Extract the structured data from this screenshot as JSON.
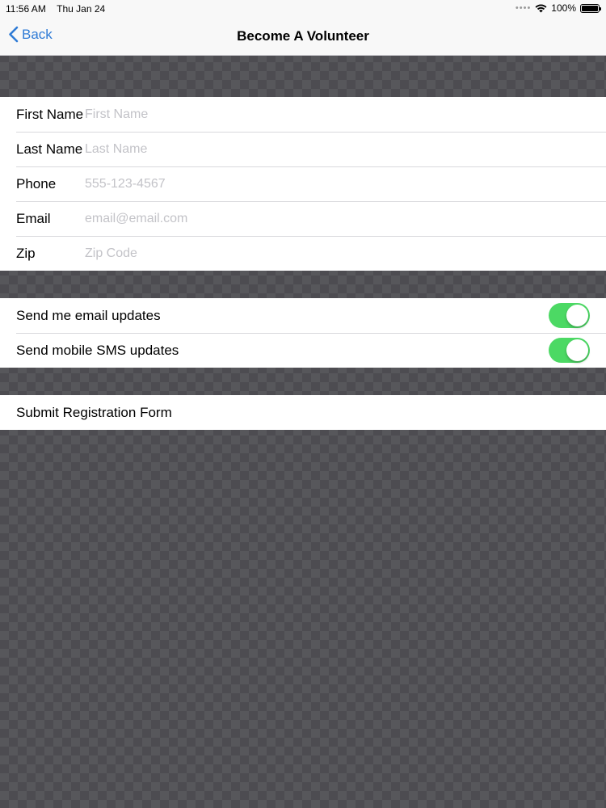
{
  "status_bar": {
    "time": "11:56 AM",
    "date": "Thu Jan 24",
    "battery": "100%",
    "signal_icon": "cellular-dots-icon",
    "wifi_icon": "wifi-icon",
    "battery_icon": "battery-icon"
  },
  "nav": {
    "back_label": "Back",
    "title": "Become A Volunteer"
  },
  "form": {
    "fields": [
      {
        "label": "First Name",
        "value": "",
        "placeholder": "First Name"
      },
      {
        "label": "Last Name",
        "value": "",
        "placeholder": "Last Name"
      },
      {
        "label": "Phone",
        "value": "",
        "placeholder": "555-123-4567"
      },
      {
        "label": "Email",
        "value": "",
        "placeholder": "email@email.com"
      },
      {
        "label": "Zip",
        "value": "",
        "placeholder": "Zip Code"
      }
    ]
  },
  "toggles": [
    {
      "label": "Send me email updates",
      "on": true
    },
    {
      "label": "Send mobile SMS updates",
      "on": true
    }
  ],
  "submit": {
    "label": "Submit Registration Form"
  },
  "colors": {
    "accent": "#2f7bd6",
    "toggle_on": "#4cd964",
    "background": "#4d4c51"
  }
}
